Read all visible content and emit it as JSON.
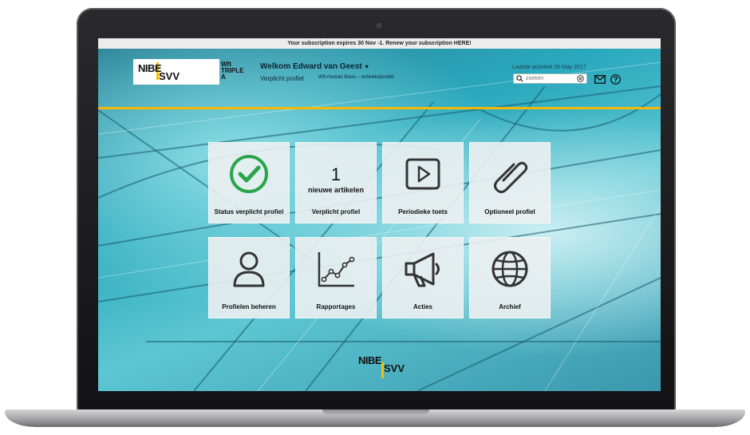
{
  "banner": {
    "text": "Your subscription expires 30 Nov -1. Renew your subscription HERE!"
  },
  "logo": {
    "line1": "NIBE",
    "line2": "SVV"
  },
  "badge": {
    "line1": "Wft",
    "line2": "TRIPLE",
    "line3": "A"
  },
  "user": {
    "welcome": "Welkom Edward van Geest",
    "profile_label": "Verplicht profiel",
    "module_label": "Wft-module Basis – ontwikkelprofiel"
  },
  "activity": {
    "text": "Laatste activiteit 29 May 2017"
  },
  "search": {
    "placeholder": "zoeken"
  },
  "colors": {
    "accent_yellow": "#f2b90a",
    "check_green": "#2aa54a"
  },
  "tiles": [
    {
      "label": "Status verplicht profiel",
      "icon": "check-circle-icon"
    },
    {
      "count": "1",
      "count_sub": "nieuwe artikelen",
      "label": "Verplicht profiel"
    },
    {
      "label": "Periodieke toets",
      "icon": "play-icon"
    },
    {
      "label": "Optioneel profiel",
      "icon": "paperclip-icon"
    },
    {
      "label": "Profielen beheren",
      "icon": "user-icon"
    },
    {
      "label": "Rapportages",
      "icon": "chart-icon"
    },
    {
      "label": "Acties",
      "icon": "megaphone-icon"
    },
    {
      "label": "Archief",
      "icon": "globe-icon"
    }
  ],
  "footer_logo": {
    "line1": "NIBE",
    "line2": "SVV"
  }
}
